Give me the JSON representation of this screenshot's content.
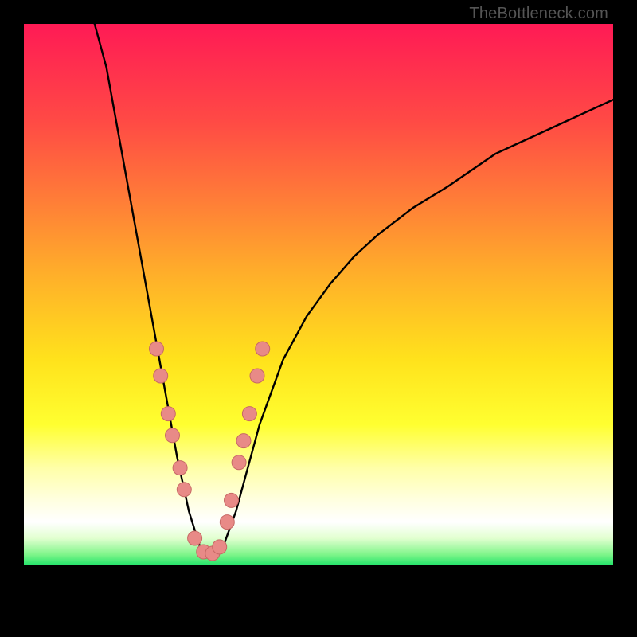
{
  "watermark": "TheBottleneck.com",
  "colors": {
    "background": "#000000",
    "curve": "#000000",
    "dots": "#e88a87",
    "dots_stroke": "#c76965"
  },
  "chart_data": {
    "type": "line",
    "title": "",
    "xlabel": "",
    "ylabel": "",
    "xlim": [
      0,
      100
    ],
    "ylim": [
      0,
      100
    ],
    "legend": false,
    "grid": false,
    "curve": {
      "description": "V-shaped bottleneck curve with minimum near 31",
      "x": [
        12,
        14,
        16,
        18,
        20,
        22,
        24,
        26,
        28,
        30,
        32,
        34,
        36,
        38,
        40,
        44,
        48,
        52,
        56,
        60,
        66,
        72,
        80,
        88,
        96,
        100
      ],
      "y": [
        100,
        92,
        80,
        68,
        56,
        44,
        32,
        20,
        10,
        3,
        2,
        4,
        10,
        18,
        26,
        38,
        46,
        52,
        57,
        61,
        66,
        70,
        76,
        80,
        84,
        86
      ]
    },
    "dots": [
      {
        "x": 22.5,
        "y": 40
      },
      {
        "x": 23.2,
        "y": 35
      },
      {
        "x": 24.5,
        "y": 28
      },
      {
        "x": 25.2,
        "y": 24
      },
      {
        "x": 26.5,
        "y": 18
      },
      {
        "x": 27.2,
        "y": 14
      },
      {
        "x": 29.0,
        "y": 5
      },
      {
        "x": 30.5,
        "y": 2.5
      },
      {
        "x": 32.0,
        "y": 2.2
      },
      {
        "x": 33.2,
        "y": 3.4
      },
      {
        "x": 34.5,
        "y": 8
      },
      {
        "x": 35.2,
        "y": 12
      },
      {
        "x": 36.5,
        "y": 19
      },
      {
        "x": 37.3,
        "y": 23
      },
      {
        "x": 38.3,
        "y": 28
      },
      {
        "x": 39.6,
        "y": 35
      },
      {
        "x": 40.5,
        "y": 40
      }
    ]
  }
}
